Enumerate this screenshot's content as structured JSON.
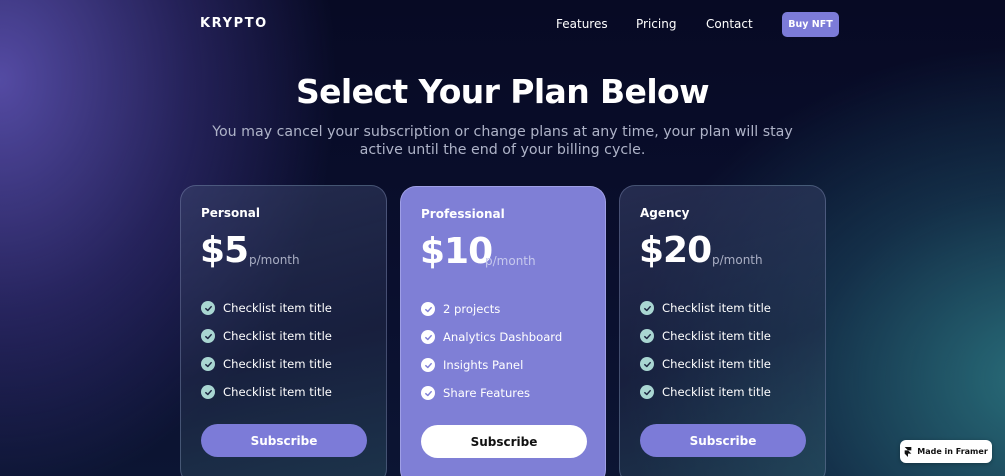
{
  "nav": {
    "logo": "KRYPTO",
    "links": [
      "Features",
      "Pricing",
      "Contact"
    ],
    "cta": "Buy NFT"
  },
  "header": {
    "title": "Select Your Plan Below",
    "subtitle": "You may cancel your subscription or change plans at any time, your plan will stay active until the end of your billing cycle."
  },
  "plans": [
    {
      "name": "Personal",
      "price": "$5",
      "period": "p/month",
      "features": [
        "Checklist item title",
        "Checklist item title",
        "Checklist item title",
        "Checklist item title"
      ],
      "button": "Subscribe"
    },
    {
      "name": "Professional",
      "price": "$10",
      "period": "p/month",
      "features": [
        "2 projects",
        "Analytics Dashboard",
        "Insights Panel",
        "Share Features"
      ],
      "button": "Subscribe"
    },
    {
      "name": "Agency",
      "price": "$20",
      "period": "p/month",
      "features": [
        "Checklist item title",
        "Checklist item title",
        "Checklist item title",
        "Checklist item title"
      ],
      "button": "Subscribe"
    }
  ],
  "badge": {
    "label": "Made in Framer",
    "icon": "framer-icon"
  },
  "colors": {
    "accent": "#7c7bd8",
    "featured_card": "#7f7fd6",
    "check_glass": "#a9d6d2",
    "background": "#0a0f2e"
  }
}
